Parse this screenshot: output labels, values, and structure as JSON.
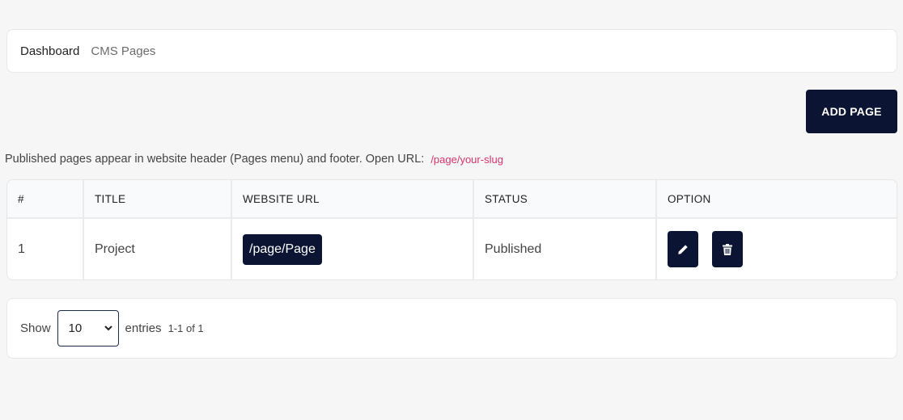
{
  "breadcrumb": {
    "home": "Dashboard",
    "current": "CMS Pages"
  },
  "toolbar": {
    "add_label": "ADD PAGE"
  },
  "info": {
    "text": "Published pages appear in website header (Pages menu) and footer. Open URL:",
    "example_url": "/page/your-slug"
  },
  "table": {
    "headers": [
      "#",
      "TITLE",
      "WEBSITE URL",
      "STATUS",
      "OPTION"
    ],
    "rows": [
      {
        "num": "1",
        "title": "Project",
        "url": "/page/Page",
        "status": "Published"
      }
    ]
  },
  "pagination": {
    "show_label": "Show",
    "per_page": "10",
    "entries_label": "entries",
    "range": "1-1 of 1"
  },
  "colors": {
    "primary": "#0b1533",
    "accent_code": "#d6336c",
    "background": "#f6f6f6"
  },
  "icons": {
    "edit": "pencil-icon",
    "delete": "trash-icon",
    "select": "chevron-down-icon"
  }
}
